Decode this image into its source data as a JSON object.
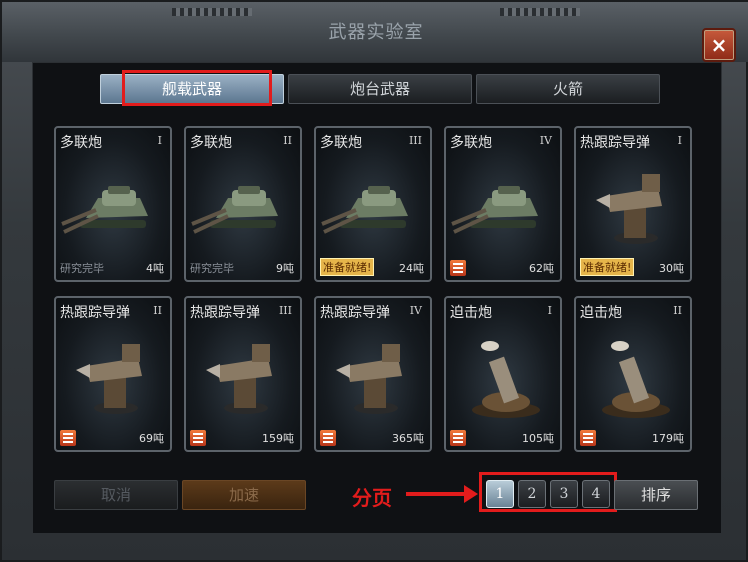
{
  "window": {
    "title": "武器实验室",
    "close": "×"
  },
  "tabs": [
    {
      "label": "舰载武器",
      "active": true
    },
    {
      "label": "炮台武器",
      "active": false
    },
    {
      "label": "火箭",
      "active": false
    }
  ],
  "cards": [
    {
      "name": "多联炮",
      "level": "I",
      "status": "研究完毕",
      "weight": "4吨",
      "icon": "turret-icon"
    },
    {
      "name": "多联炮",
      "level": "II",
      "status": "研究完毕",
      "weight": "9吨",
      "icon": "turret-icon"
    },
    {
      "name": "多联炮",
      "level": "III",
      "status": "准备就绪!",
      "weight": "24吨",
      "icon": "turret-icon"
    },
    {
      "name": "多联炮",
      "level": "IV",
      "status": "",
      "weight": "62吨",
      "icon": "turret-icon"
    },
    {
      "name": "热跟踪导弹",
      "level": "I",
      "status": "准备就绪!",
      "weight": "30吨",
      "icon": "missile-launcher-icon"
    },
    {
      "name": "热跟踪导弹",
      "level": "II",
      "status": "",
      "weight": "69吨",
      "icon": "missile-launcher-icon"
    },
    {
      "name": "热跟踪导弹",
      "level": "III",
      "status": "",
      "weight": "159吨",
      "icon": "missile-launcher-icon"
    },
    {
      "name": "热跟踪导弹",
      "level": "IV",
      "status": "",
      "weight": "365吨",
      "icon": "missile-launcher-icon"
    },
    {
      "name": "迫击炮",
      "level": "I",
      "status": "",
      "weight": "105吨",
      "icon": "mortar-icon"
    },
    {
      "name": "迫击炮",
      "level": "II",
      "status": "",
      "weight": "179吨",
      "icon": "mortar-icon"
    }
  ],
  "buttons": {
    "cancel": "取消",
    "accelerate": "加速",
    "sort": "排序"
  },
  "pagination": {
    "pages": [
      "1",
      "2",
      "3",
      "4"
    ],
    "current": "1"
  },
  "annotation": {
    "label": "分页"
  },
  "colors": {
    "highlight": "#e21c1c",
    "ready": "#e6b54a",
    "lock": "#f27a3a"
  }
}
